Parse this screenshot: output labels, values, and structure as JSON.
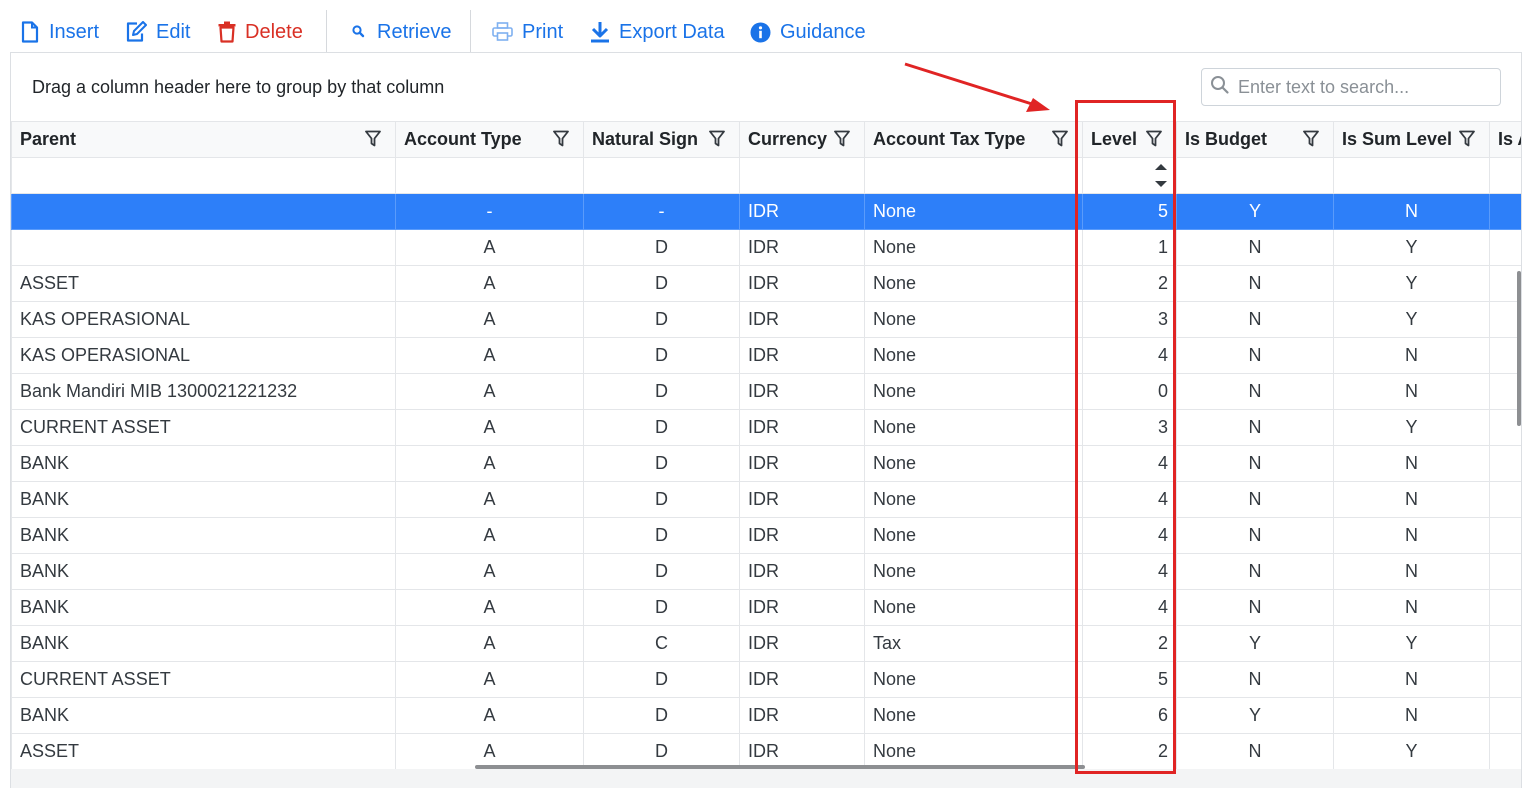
{
  "toolbar": {
    "insert": "Insert",
    "edit": "Edit",
    "delete": "Delete",
    "retrieve": "Retrieve",
    "print": "Print",
    "export": "Export Data",
    "guidance": "Guidance"
  },
  "grid": {
    "group_hint": "Drag a column header here to group by that column",
    "search_placeholder": "Enter text to search...",
    "columns": {
      "parent": "Parent",
      "account_type": "Account Type",
      "natural_sign": "Natural Sign",
      "currency": "Currency",
      "account_tax_type": "Account Tax Type",
      "level": "Level",
      "is_budget": "Is Budget",
      "is_sum_level": "Is Sum Level",
      "next": "Is A"
    },
    "rows": [
      [
        "",
        "-",
        "-",
        "IDR",
        "None",
        "5",
        "Y",
        "N"
      ],
      [
        "",
        "A",
        "D",
        "IDR",
        "None",
        "1",
        "N",
        "Y"
      ],
      [
        "ASSET",
        "A",
        "D",
        "IDR",
        "None",
        "2",
        "N",
        "Y"
      ],
      [
        "KAS OPERASIONAL",
        "A",
        "D",
        "IDR",
        "None",
        "3",
        "N",
        "Y"
      ],
      [
        "KAS OPERASIONAL",
        "A",
        "D",
        "IDR",
        "None",
        "4",
        "N",
        "N"
      ],
      [
        "Bank Mandiri MIB 1300021221232",
        "A",
        "D",
        "IDR",
        "None",
        "0",
        "N",
        "N"
      ],
      [
        "CURRENT ASSET",
        "A",
        "D",
        "IDR",
        "None",
        "3",
        "N",
        "Y"
      ],
      [
        "BANK",
        "A",
        "D",
        "IDR",
        "None",
        "4",
        "N",
        "N"
      ],
      [
        "BANK",
        "A",
        "D",
        "IDR",
        "None",
        "4",
        "N",
        "N"
      ],
      [
        "BANK",
        "A",
        "D",
        "IDR",
        "None",
        "4",
        "N",
        "N"
      ],
      [
        "BANK",
        "A",
        "D",
        "IDR",
        "None",
        "4",
        "N",
        "N"
      ],
      [
        "BANK",
        "A",
        "D",
        "IDR",
        "None",
        "4",
        "N",
        "N"
      ],
      [
        "BANK",
        "A",
        "C",
        "IDR",
        "Tax",
        "2",
        "Y",
        "Y"
      ],
      [
        "CURRENT ASSET",
        "A",
        "D",
        "IDR",
        "None",
        "5",
        "N",
        "N"
      ],
      [
        "BANK",
        "A",
        "D",
        "IDR",
        "None",
        "6",
        "Y",
        "N"
      ],
      [
        "ASSET",
        "A",
        "D",
        "IDR",
        "None",
        "2",
        "N",
        "Y"
      ]
    ]
  },
  "colors": {
    "accent": "#1a73e8",
    "danger": "#d93025",
    "selected_row": "#2d7ff9",
    "annotation": "#e02424"
  }
}
